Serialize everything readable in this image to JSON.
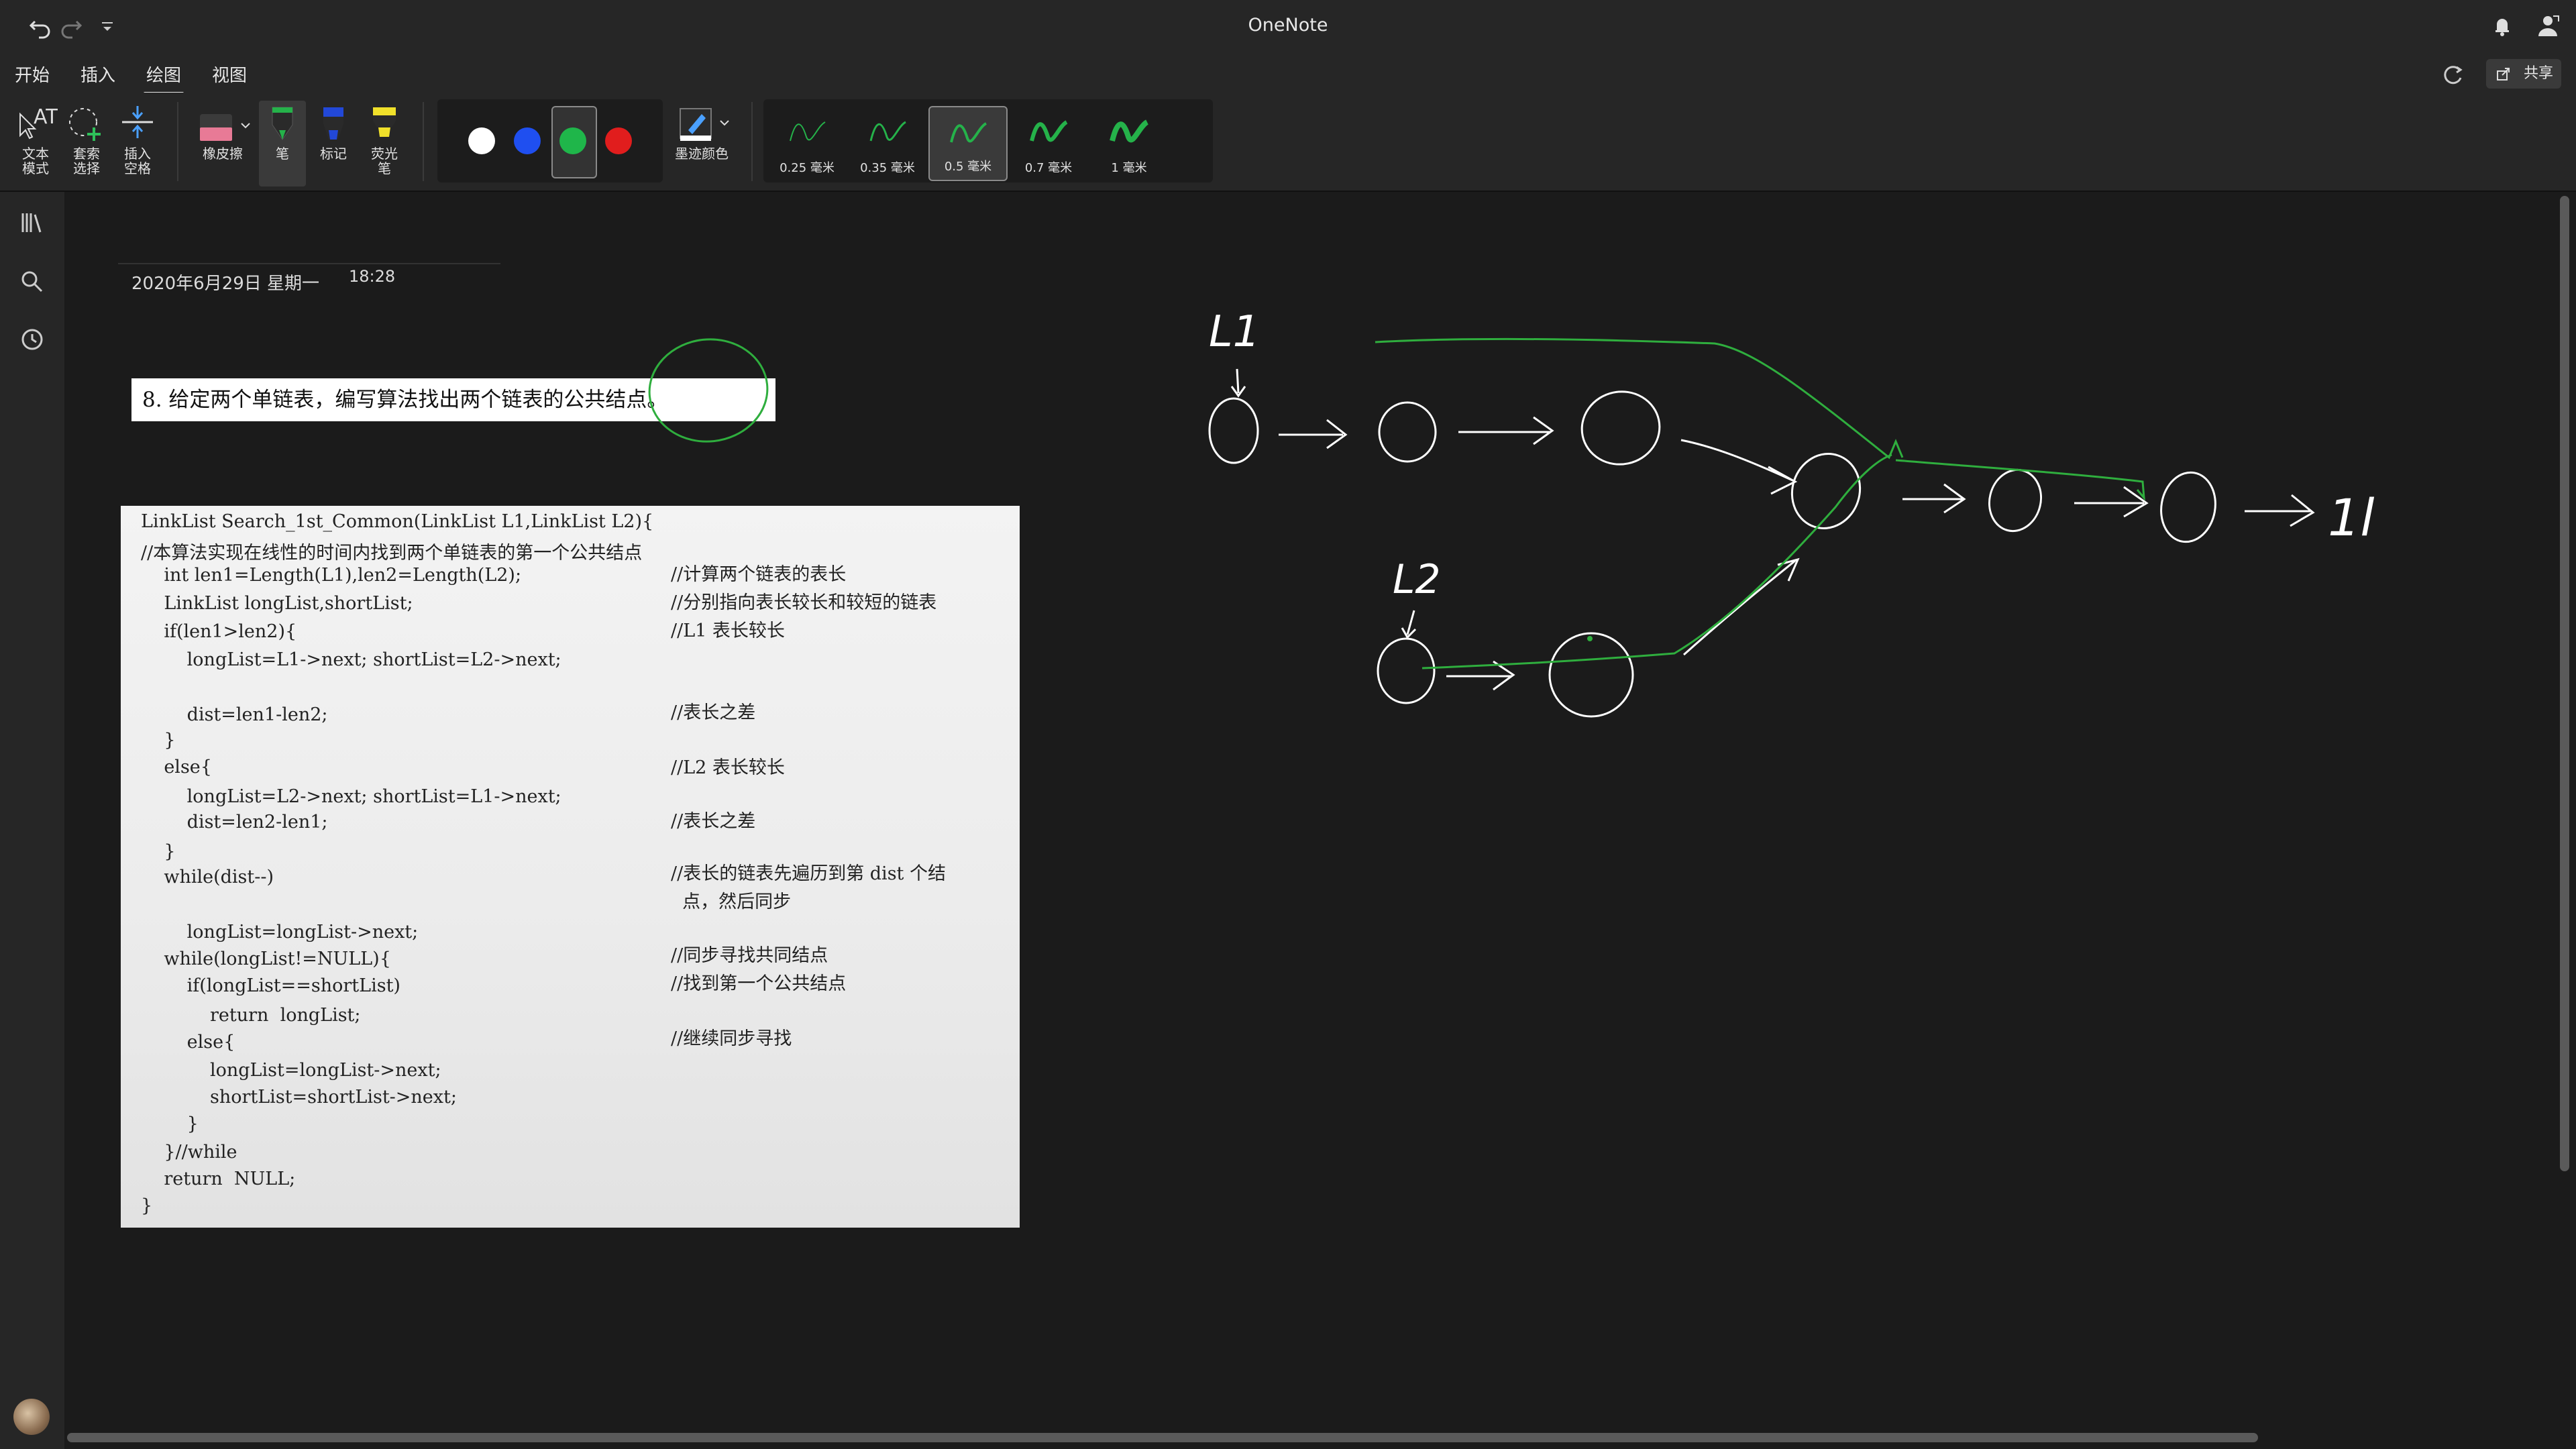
{
  "app": {
    "title": "OneNote"
  },
  "ribbon_tabs": [
    {
      "label": "开始"
    },
    {
      "label": "插入"
    },
    {
      "label": "绘图",
      "active": true
    },
    {
      "label": "视图"
    }
  ],
  "share_label": "共享",
  "tools": {
    "text_mode": "文本\n模式",
    "lasso": "套索\n选择",
    "insert_space": "插入\n空格",
    "eraser": "橡皮擦",
    "pen": "笔",
    "marker": "标记",
    "highlighter": "荧光\n笔",
    "edge_color": "墨迹颜色"
  },
  "colors": [
    {
      "name": "white",
      "hex": "#ffffff"
    },
    {
      "name": "blue",
      "hex": "#1f4ff0"
    },
    {
      "name": "green",
      "hex": "#1fb64a",
      "selected": true
    },
    {
      "name": "red",
      "hex": "#e11d1d"
    }
  ],
  "thicknesses": [
    {
      "label": "0.25 毫米"
    },
    {
      "label": "0.35 毫米"
    },
    {
      "label": "0.5 毫米",
      "selected": true
    },
    {
      "label": "0.7 毫米"
    },
    {
      "label": "1 毫米"
    }
  ],
  "page": {
    "date": "2020年6月29日 星期一",
    "time": "18:28",
    "question": "8.  给定两个单链表，编写算法找出两个链表的公共结点。",
    "code_lines": [
      "LinkList Search_1st_Common(LinkList L1,LinkList L2){",
      "//本算法实现在线性的时间内找到两个单链表的第一个公共结点",
      "    int len1=Length(L1),len2=Length(L2);",
      "    LinkList longList,shortList;",
      "    if(len1>len2){",
      "        longList=L1->next; shortList=L2->next;",
      "        dist=len1-len2;",
      "    }",
      "    else{",
      "        longList=L2->next; shortList=L1->next;",
      "        dist=len2-len1;",
      "    }",
      "    while(dist--)",
      "        longList=longList->next;",
      "    while(longList!=NULL){",
      "        if(longList==shortList)",
      "            return  longList;",
      "        else{",
      "            longList=longList->next;",
      "            shortList=shortList->next;",
      "        }",
      "    }//while",
      "    return  NULL;",
      "}"
    ],
    "code_comments": [
      "//计算两个链表的表长",
      "//分别指向表长较长和较短的链表",
      "//L1 表长较长",
      "//表长之差",
      "//L2 表长较长",
      "//表长之差",
      "//表长的链表先遍历到第 dist 个结",
      "  点，然后同步",
      "//同步寻找共同结点",
      "//找到第一个公共结点",
      "//继续同步寻找"
    ]
  },
  "ink": {
    "labels": [
      "L1",
      "L2"
    ],
    "null_label": "1l"
  }
}
